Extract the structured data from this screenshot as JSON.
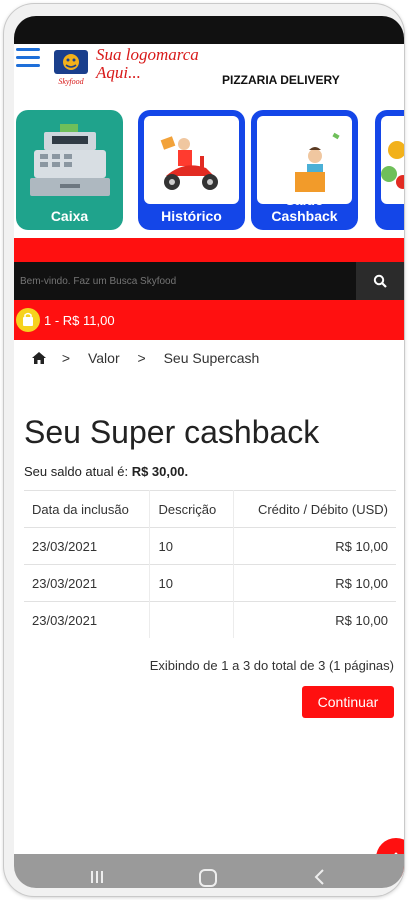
{
  "header": {
    "brand_line1": "Sua logomarca",
    "brand_line2": "Aqui...",
    "logo_text": "Skyfood",
    "store_name": "PIZZARIA DELIVERY"
  },
  "tiles": [
    {
      "label": "Caixa"
    },
    {
      "label": "Histórico"
    },
    {
      "label": "Saldo Cashback"
    }
  ],
  "search": {
    "placeholder": "Bem-vindo. Faz um Busca Skyfood"
  },
  "cart": {
    "summary": "1 - R$ 11,00"
  },
  "breadcrumb": {
    "home": "home",
    "items": [
      "Valor",
      "Seu Supercash"
    ]
  },
  "page": {
    "title": "Seu Super cashback",
    "balance_prefix": "Seu saldo atual é:",
    "balance_value": "R$ 30,00."
  },
  "table": {
    "headers": [
      "Data da inclusão",
      "Descrição",
      "Crédito / Débito (USD)"
    ],
    "rows": [
      {
        "date": "23/03/2021",
        "desc": "10",
        "amount": "R$ 10,00"
      },
      {
        "date": "23/03/2021",
        "desc": "10",
        "amount": "R$ 10,00"
      },
      {
        "date": "23/03/2021",
        "desc": "",
        "amount": "R$ 10,00"
      }
    ]
  },
  "pager": "Exibindo de 1 a 3 do total de 3 (1 páginas)",
  "buttons": {
    "continue": "Continuar"
  },
  "colors": {
    "accent_red": "#ff1010",
    "tile_teal": "#1fa38c",
    "tile_blue": "#1446e8",
    "brand_red": "#d81919"
  }
}
